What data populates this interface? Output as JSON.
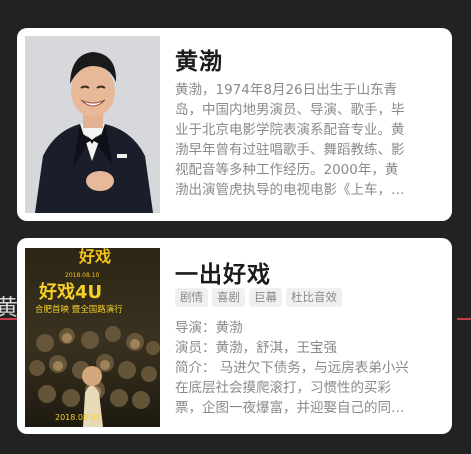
{
  "background_fragment": "黄",
  "person": {
    "name": "黄渤",
    "description_lines": [
      "黄渤，1974年8月26日出生于山东青",
      "岛，中国内地男演员、导演、歌手，毕",
      "业于北京电影学院表演系配音专业。黄",
      "渤早年曾有过驻唱歌手、舞蹈教练、影",
      "视配音等多种工作经历。2000年，黄",
      "渤出演管虎执导的电视电影《上车，…"
    ]
  },
  "movie": {
    "title": "一出好戏",
    "tags": [
      "剧情",
      "喜剧",
      "巨幕",
      "杜比音效"
    ],
    "director_label": "导演：",
    "director": "黄渤",
    "cast_label": "演员：",
    "cast": "黄渤，舒淇，王宝强",
    "synopsis_lines": [
      "简介：  马进欠下债务，与远房表弟小兴",
      "在底层社会摸爬滚打，习惯性的买彩",
      "票，企图一夜爆富，并迎娶自己的同…"
    ],
    "poster": {
      "top_title": "好戏",
      "date_top": "2018.08.10",
      "big_title": "好戏4U",
      "subtitle": "合肥首映 暨全国路演行",
      "bottom_date": "2018.08.01"
    }
  },
  "colors": {
    "accent": "#c73a4a",
    "card_bg": "#ffffff",
    "muted_text": "#8a8a8a",
    "title_text": "#1b1b1b"
  }
}
